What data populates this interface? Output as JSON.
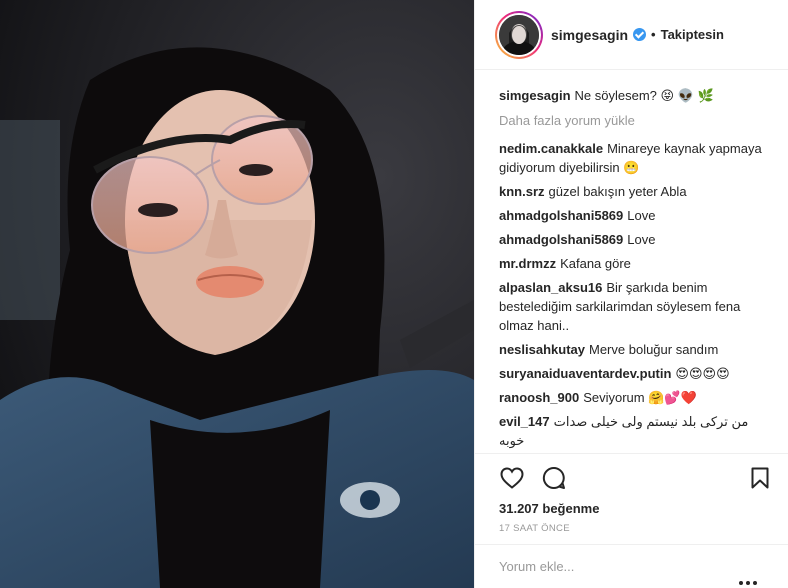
{
  "header": {
    "username": "simgesagin",
    "separator": "•",
    "follow_label": "Takiptesin"
  },
  "caption": {
    "username": "simgesagin",
    "text": "Ne söylesem? 😝 👽 🌿"
  },
  "load_more_label": "Daha fazla yorum yükle",
  "comments": [
    {
      "username": "nedim.canakkale",
      "text": "Minareye kaynak yapmaya gidiyorum diyebilirsin 😬"
    },
    {
      "username": "knn.srz",
      "text": "güzel bakışın yeter Abla"
    },
    {
      "username": "ahmadgolshani5869",
      "text": "Love"
    },
    {
      "username": "ahmadgolshani5869",
      "text": "Love"
    },
    {
      "username": "mr.drmzz",
      "text": "Kafana göre"
    },
    {
      "username": "alpaslan_aksu16",
      "text": "Bir şarkıda benim bestelediğim sarkilarimdan söylesem fena olmaz hani.."
    },
    {
      "username": "neslisahkutay",
      "text": "Merve boluğur sandım"
    },
    {
      "username": "suryanaiduaventardev.putin",
      "text": "😍😍😍😍"
    },
    {
      "username": "ranoosh_900",
      "text": "Seviyorum 🤗💕❤️"
    },
    {
      "username": "evil_147",
      "text": "من ترکی بلد نیستم ولی خیلی صدات خوبه"
    }
  ],
  "actions": {
    "likes": "31.207 beğenme",
    "time": "17 SAAT ÖNCE"
  },
  "add_comment": {
    "placeholder": "Yorum ekle..."
  },
  "icons": {
    "like": "heart-icon",
    "comment": "comment-bubble-icon",
    "save": "bookmark-icon",
    "verified": "verified-badge-icon",
    "more": "more-dots-icon"
  },
  "colors": {
    "verified": "#3897f0",
    "muted": "#999999",
    "text": "#262626",
    "border": "#efefef"
  }
}
